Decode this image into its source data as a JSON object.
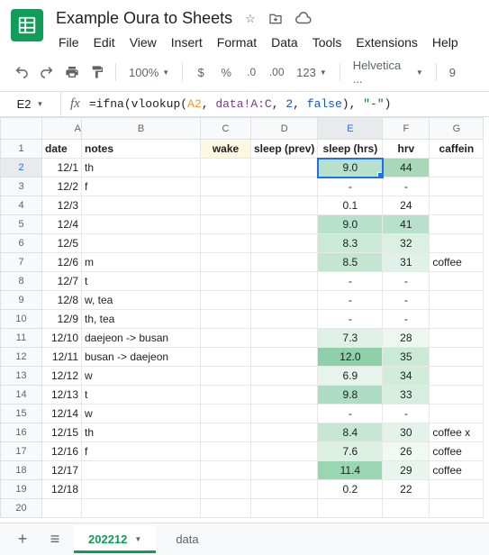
{
  "doc": {
    "title": "Example Oura to Sheets"
  },
  "menus": [
    "File",
    "Edit",
    "View",
    "Insert",
    "Format",
    "Data",
    "Tools",
    "Extensions",
    "Help"
  ],
  "toolbar": {
    "zoom": "100%",
    "font": "Helvetica ...",
    "font_size": "9"
  },
  "formula_bar": {
    "cell_ref": "E2",
    "formula_parts": {
      "p1": "=",
      "fn1": "ifna",
      "p2": "(",
      "fn2": "vlookup",
      "p3": "(",
      "ref1": "A2",
      "p4": ", ",
      "ref2": "data!A:C",
      "p5": ", ",
      "num1": "2",
      "p6": ", ",
      "bool1": "false",
      "p7": "), ",
      "str1": "\"-\"",
      "p8": ")"
    }
  },
  "columns": [
    "A",
    "B",
    "C",
    "D",
    "E",
    "F",
    "G"
  ],
  "headers": {
    "A": "date",
    "B": "notes",
    "C": "wake",
    "D": "sleep (prev)",
    "E": "sleep (hrs)",
    "F": "hrv",
    "G": "caffein"
  },
  "rows": [
    {
      "n": "1"
    },
    {
      "n": "2",
      "A": "12/1",
      "B": "th",
      "E": "9.0",
      "F": "44",
      "Ecol": "#b7e1cd",
      "Fcol": "#a8d7b9"
    },
    {
      "n": "3",
      "A": "12/2",
      "B": "f",
      "E": "-",
      "F": "-"
    },
    {
      "n": "4",
      "A": "12/3",
      "E": "0.1",
      "F": "24"
    },
    {
      "n": "5",
      "A": "12/4",
      "E": "9.0",
      "F": "41",
      "Ecol": "#b7e1cd",
      "Fcol": "#b7e1cd"
    },
    {
      "n": "6",
      "A": "12/5",
      "E": "8.3",
      "F": "32",
      "Ecol": "#cbe9d7",
      "Fcol": "#daf0e2"
    },
    {
      "n": "7",
      "A": "12/6",
      "B": "m",
      "E": "8.5",
      "F": "31",
      "G": "coffee",
      "Ecol": "#c3e5d1",
      "Fcol": "#e0f2e7"
    },
    {
      "n": "8",
      "A": "12/7",
      "B": "t",
      "E": "-",
      "F": "-"
    },
    {
      "n": "9",
      "A": "12/8",
      "B": "w, tea",
      "E": "-",
      "F": "-"
    },
    {
      "n": "10",
      "A": "12/9",
      "B": "th, tea",
      "E": "-",
      "F": "-"
    },
    {
      "n": "11",
      "A": "12/10",
      "B": "daejeon -> busan",
      "E": "7.3",
      "F": "28",
      "Ecol": "#dff1e6",
      "Fcol": "#ecf7f0"
    },
    {
      "n": "12",
      "A": "12/11",
      "B": "busan -> daejeon",
      "E": "12.0",
      "F": "35",
      "Ecol": "#8ed0a7",
      "Fcol": "#cbe9d7"
    },
    {
      "n": "13",
      "A": "12/12",
      "B": "w",
      "E": "6.9",
      "F": "34",
      "Ecol": "#e7f4eb",
      "Fcol": "#d1ecdb"
    },
    {
      "n": "14",
      "A": "12/13",
      "B": "t",
      "E": "9.8",
      "F": "33",
      "Ecol": "#afdcc5",
      "Fcol": "#d6eedf"
    },
    {
      "n": "15",
      "A": "12/14",
      "B": "w",
      "E": "-",
      "F": "-"
    },
    {
      "n": "16",
      "A": "12/15",
      "B": "th",
      "E": "8.4",
      "F": "30",
      "G": "coffee x",
      "Ecol": "#c7e7d4",
      "Fcol": "#e4f3e9"
    },
    {
      "n": "17",
      "A": "12/16",
      "B": "f",
      "E": "7.6",
      "F": "26",
      "G": "coffee",
      "Ecol": "#dbf0e2",
      "Fcol": "#f1f9f4"
    },
    {
      "n": "18",
      "A": "12/17",
      "E": "11.4",
      "F": "29",
      "G": "coffee",
      "Ecol": "#9ad6b1",
      "Fcol": "#e8f5ec"
    },
    {
      "n": "19",
      "A": "12/18",
      "E": "0.2",
      "F": "22"
    },
    {
      "n": "20"
    }
  ],
  "active": {
    "row": 2,
    "col": "E"
  },
  "sheet_tabs": {
    "active": "202212",
    "other": "data"
  }
}
